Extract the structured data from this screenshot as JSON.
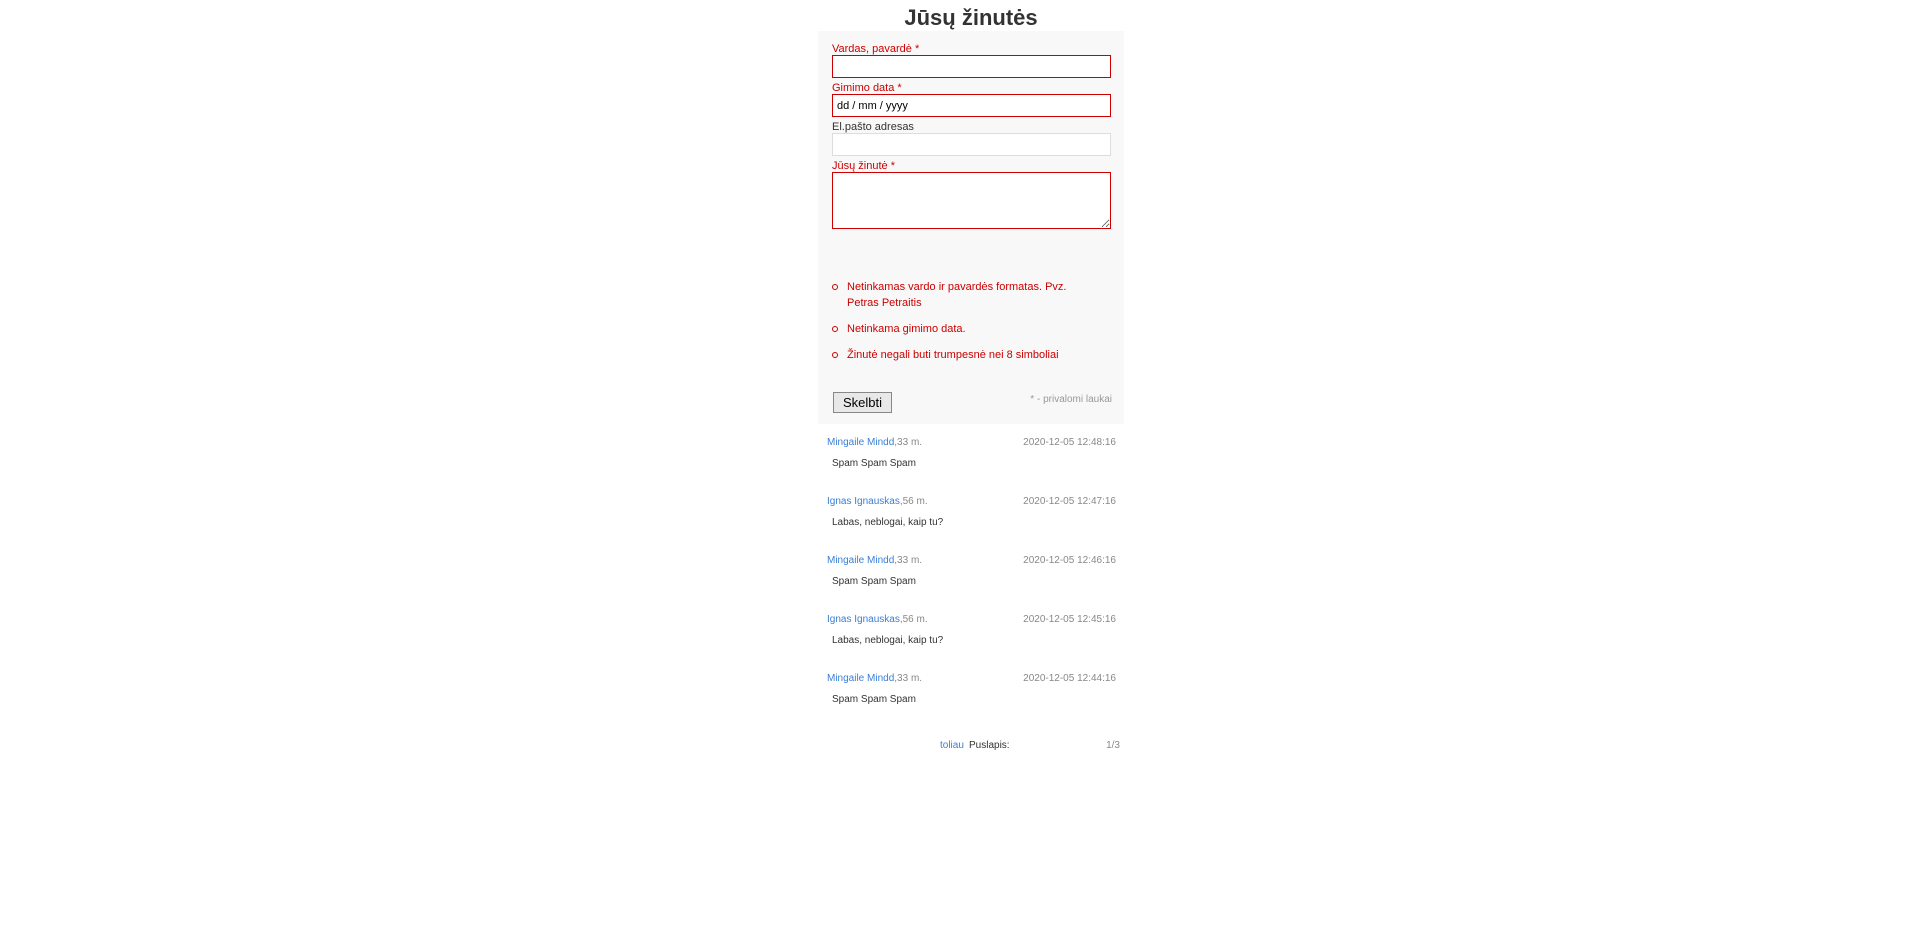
{
  "page": {
    "title": "Jūsų žinutės"
  },
  "form": {
    "name_label": "Vardas, pavardė *",
    "name_value": "",
    "birth_label": "Gimimo data *",
    "birth_value": "dd / mm / yyyy",
    "email_label": "El.pašto adresas",
    "email_value": "",
    "message_label": "Jūsų žinutė *",
    "message_value": "",
    "errors": [
      "Netinkamas vardo ir pavardės formatas. Pvz. Petras Petraitis",
      "Netinkama gimimo data.",
      "Žinutė negali buti trumpesnė nei 8 simboliai"
    ],
    "submit_label": "Skelbti",
    "required_note": "* - privalomi laukai"
  },
  "messages": [
    {
      "name": "Mingaile Mindd",
      "age": ",33 m.",
      "date": "2020-12-05 12:48:16",
      "text": "Spam Spam Spam"
    },
    {
      "name": "Ignas Ignauskas",
      "age": ",56 m.",
      "date": "2020-12-05 12:47:16",
      "text": "Labas, neblogai, kaip tu?"
    },
    {
      "name": "Mingaile Mindd",
      "age": ",33 m.",
      "date": "2020-12-05 12:46:16",
      "text": "Spam Spam Spam"
    },
    {
      "name": "Ignas Ignauskas",
      "age": ",56 m.",
      "date": "2020-12-05 12:45:16",
      "text": "Labas, neblogai, kaip tu?"
    },
    {
      "name": "Mingaile Mindd",
      "age": ",33 m.",
      "date": "2020-12-05 12:44:16",
      "text": "Spam Spam Spam"
    }
  ],
  "pager": {
    "next_label": "toliau",
    "page_label": "Puslapis:",
    "page_number": "1/3"
  },
  "colors": {
    "error": "#cc0000",
    "link": "#3a7fd5",
    "muted": "#888888",
    "form_background": "#f8f8f8"
  }
}
